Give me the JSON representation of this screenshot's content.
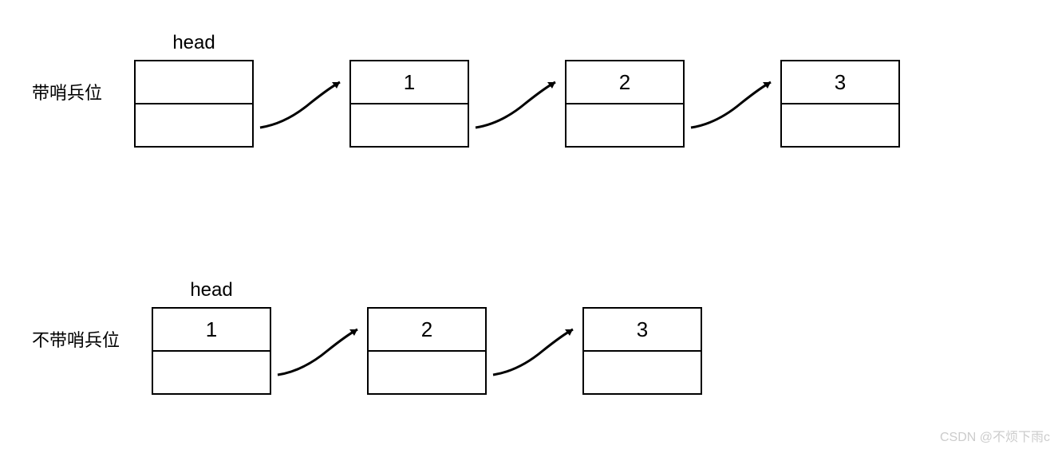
{
  "row1": {
    "label": "带哨兵位",
    "headLabel": "head",
    "nodes": [
      {
        "value": ""
      },
      {
        "value": "1"
      },
      {
        "value": "2"
      },
      {
        "value": "3"
      }
    ]
  },
  "row2": {
    "label": "不带哨兵位",
    "headLabel": "head",
    "nodes": [
      {
        "value": "1"
      },
      {
        "value": "2"
      },
      {
        "value": "3"
      }
    ]
  },
  "watermark": "CSDN @不烦下雨c"
}
